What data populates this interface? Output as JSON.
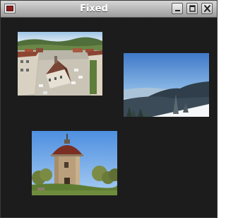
{
  "window": {
    "title": "Fixed"
  },
  "titlebar": {
    "icons": [
      "app-icon",
      "minimize-icon",
      "maximize-icon",
      "close-icon"
    ]
  },
  "content": {
    "background": "#1c1c1c",
    "images": [
      {
        "name": "town-square-photo"
      },
      {
        "name": "mountain-landscape-photo"
      },
      {
        "name": "rotunda-photo"
      }
    ]
  }
}
